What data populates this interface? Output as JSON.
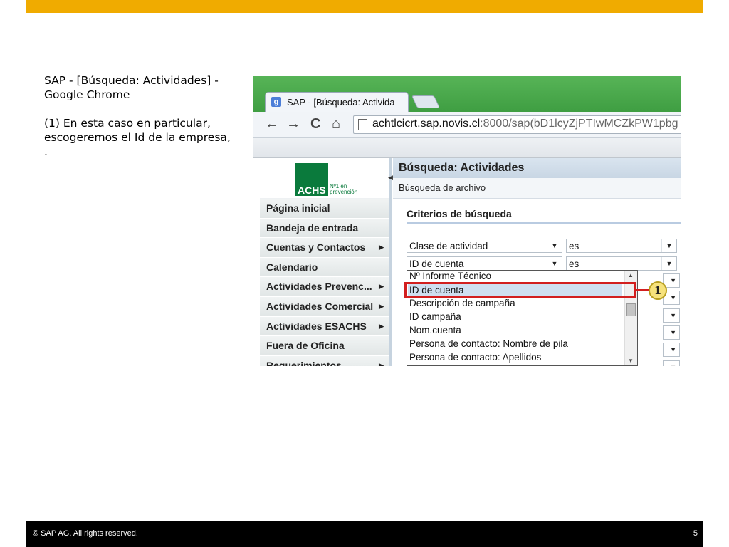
{
  "slide": {
    "description_title": "SAP - [Búsqueda: Actividades] - Google Chrome",
    "description_step": "(1) En esta caso en particular, escogeremos el Id de la empresa, .",
    "footer_copyright": "©  SAP AG. All rights reserved.",
    "page_number": "5",
    "accent_color": "#f0ab00"
  },
  "browser": {
    "tab_title": "SAP - [Búsqueda: Activida",
    "tab_icon": "google-g-icon",
    "url_host": "achtlcicrt.sap.novis.cl",
    "url_rest": ":8000/sap(bD1lcyZjPTIwMCZkPW1pbg",
    "back_icon": "←",
    "forward_icon": "→",
    "reload_icon": "C",
    "home_icon": "⌂"
  },
  "sidebar": {
    "logo_text": "ACHS",
    "logo_tagline_1": "Nº1 en",
    "logo_tagline_2": "prevención",
    "items": [
      {
        "label": "Página inicial",
        "submenu": false
      },
      {
        "label": "Bandeja de entrada",
        "submenu": false
      },
      {
        "label": "Cuentas y Contactos",
        "submenu": true
      },
      {
        "label": "Calendario",
        "submenu": false
      },
      {
        "label": "Actividades Prevenc...",
        "submenu": true
      },
      {
        "label": "Actividades Comercial",
        "submenu": true
      },
      {
        "label": "Actividades ESACHS",
        "submenu": true
      },
      {
        "label": "Fuera de Oficina",
        "submenu": false
      },
      {
        "label": "Requerimientos",
        "submenu": true
      }
    ]
  },
  "main": {
    "title": "Búsqueda: Actividades",
    "subtitle": "Búsqueda de archivo",
    "criteria_title": "Criterios de búsqueda",
    "row1_field": "Clase de actividad",
    "row1_operator": "es",
    "row2_field": "ID de cuenta",
    "row2_operator": "es",
    "dropdown_options": [
      "Nº Informe Técnico",
      "ID de cuenta",
      "Descripción de campaña",
      "ID campaña",
      "Nom.cuenta",
      "Persona de contacto: Nombre de pila",
      "Persona de contacto: Apellidos"
    ],
    "selected_option": "ID de cuenta",
    "callout_number": "1"
  }
}
